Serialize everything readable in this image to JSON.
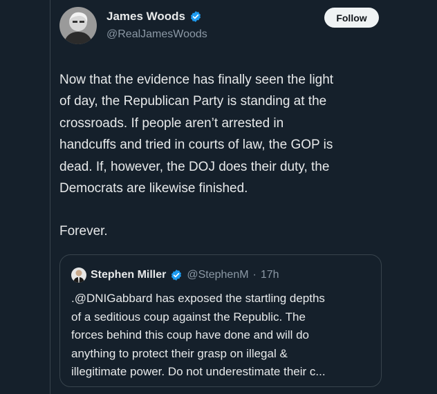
{
  "tweet": {
    "author_name": "James Woods",
    "author_handle": "@RealJamesWoods",
    "follow_label": "Follow",
    "body": "Now that the evidence has finally seen the light\nof day, the Republican Party is standing at the\ncrossroads. If people aren’t arrested in\nhandcuffs and tried in courts of law, the GOP is\ndead. If, however, the DOJ does their duty, the\nDemocrats are likewise finished.",
    "body_2": "Forever."
  },
  "quoted_tweet": {
    "author_name": "Stephen Miller",
    "author_handle": "@StephenM",
    "separator": "·",
    "time": "17h",
    "body": ".@DNIGabbard has exposed the startling depths\nof a seditious coup against the Republic. The\nforces behind this coup have done and will do\nanything to protect their grasp on illegal &\nillegitimate power. Do not underestimate their c..."
  },
  "icons": {
    "verified": "verified-badge-icon",
    "avatar": "profile-photo"
  },
  "colors": {
    "background": "#15202b",
    "verified": "#1d9bf0",
    "secondary_text": "#8b98a5",
    "border": "#38444d"
  }
}
